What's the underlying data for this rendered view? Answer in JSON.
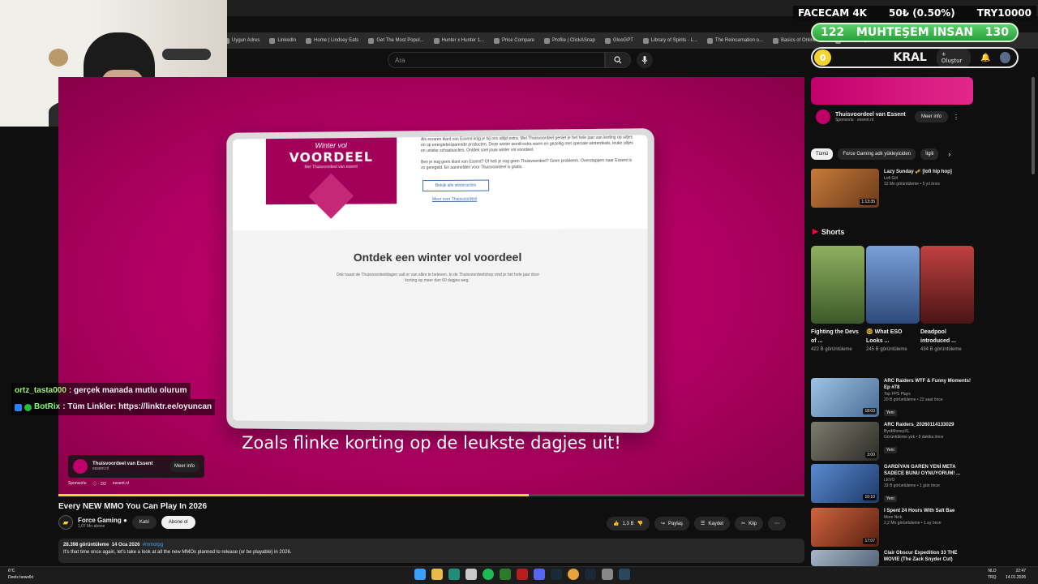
{
  "bookmarks": [
    "Uygun Adres",
    "LinkedIn",
    "Home | Lindsey Eats",
    "Get The Most Popul...",
    "Hunter x Hunter 1...",
    "Price Compare",
    "Profile | ClickASnap",
    "GlooGPT",
    "Library of Spirits - L...",
    "The Reincarnation o...",
    "Basics of Online M...",
    "Tüm Yer İşaretleri"
  ],
  "search": {
    "placeholder": "Ara"
  },
  "overlay": {
    "facecam": "FACECAM 4K",
    "price": "50₺ (0.50%)",
    "goal": "TRY10000",
    "left_num": "122",
    "name": "MUHTEŞEM INSAN",
    "right_num": "130",
    "coin": "0",
    "kral": "KRAL",
    "create": "Oluştur"
  },
  "tablet": {
    "banner_script": "Winter vol",
    "banner_big": "VOORDEEL",
    "banner_small": "Met Thuisvoordeel van essent",
    "para1": "Als ervaren klant van Essent krijg je bij ons altijd extra. Met Thuisvoordeel geniet je het hele jaar van korting op uitjes en op energiebesparende producten. Deze winter wordt extra warm en gezellig met speciale winterdeals, leuke uitjes en unieke schaatsacties. Ontdek snel jouw winter vol voordeel.",
    "para2": "Ben je nog geen klant van Essent? Of heb je nog geen Thuisvoordeel? Geen probleem. Overstappen naar Essent is zo geregeld. En aanmelden voor Thuisvoordeel is gratis.",
    "button": "Bekijk alle winteracties",
    "link": "Meer over Thuisvoordeel",
    "heading": "Ontdek een winter vol voordeel",
    "sub": "Ook naast de Thuisvoordeeldagen valt er van alles te beleven. In de Thuisvoordeelshop vind je het hele jaar door korting op meer dan 60 dagjes weg."
  },
  "video_subtitle": "Zoals flinke korting op de leukste dagjes uit!",
  "chat": [
    {
      "user": "ortz_tasta000",
      "msg": ": gerçek manada mutlu olurum"
    },
    {
      "user": "BotRix",
      "msg": ": Tüm Linkler: https://linktr.ee/oyuncan"
    }
  ],
  "ad": {
    "title": "Thuisvoordeel van Essent",
    "domain": "essent.nl",
    "cta": "Meer info",
    "sponsor": "Sponsorlu",
    "count": "2/2",
    "site": "essent.nl"
  },
  "video": {
    "title": "Every NEW MMO You Can Play In 2026",
    "channel": "Force Gaming",
    "subs": "1,07 Mn abone",
    "join": "Katıl",
    "subscribe": "Abone ol",
    "likes": "1,3 B",
    "share": "Paylaş",
    "save": "Kaydet",
    "clip": "Klip",
    "views": "28.398 görüntüleme",
    "date": "14 Oca 2026",
    "hashtag": "#mmorpg",
    "description": "It's that time once again, let's take a look at all the new MMOs planned to release (or be playable) in 2026."
  },
  "side_ad": {
    "title": "Thuisvoordeel van Essent",
    "sponsor": "Sponsorlu",
    "domain": "essent.nl",
    "cta": "Meer info"
  },
  "chips": [
    "Tümü",
    "Force Gaming adlı yükleyiciden",
    "İlgili"
  ],
  "recs": [
    {
      "title": "Lazy Sunday 🎺 [lofi hip hop]",
      "channel": "Lofi Girl",
      "meta": "12 Mn görüntüleme • 5 yıl önce",
      "dur": "1:13:35",
      "color": "#9c5a2a"
    }
  ],
  "shorts_label": "Shorts",
  "shorts": [
    {
      "title": "Fighting the Devs of ...",
      "views": "422 B görüntüleme",
      "color": "#5d7a3d"
    },
    {
      "title": "🤓 What ESO Looks ...",
      "views": "245 B görüntüleme",
      "color": "#4a6fa8"
    },
    {
      "title": "Deadpool introduced ...",
      "views": "434 B görüntüleme",
      "color": "#8a2b2b"
    }
  ],
  "recs2": [
    {
      "title": "ARC Raiders WTF & Funny Moments! Ep #78",
      "channel": "Top FPS Plays",
      "meta": "20 B görüntüleme • 22 saat önce",
      "badge": "Yeni",
      "dur": "18:03",
      "color": "#6d8fb3"
    },
    {
      "title": "ARC Raiders_20260114133029",
      "channel": "ByrdMoneyXL",
      "meta": "Görüntüleme yok • 9 dakika önce",
      "badge": "Yeni",
      "dur": "3:00",
      "color": "#5a5a50"
    },
    {
      "title": "GARDİYAN GAREN YENİ META SADECE BUNU OYNUYORUM! ...",
      "channel": "LEVO",
      "meta": "33 B görüntüleme • 1 gün önce",
      "badge": "Yeni",
      "dur": "10:10",
      "color": "#3a6db0"
    },
    {
      "title": "I Spent 24 Hours With Salt Bae",
      "channel": "More Nick",
      "meta": "2,2 Mn görüntüleme • 1 ay önce",
      "badge": "",
      "dur": "17:07",
      "color": "#b0442a"
    },
    {
      "title": "Clair Obscur Expedition 33 THE MOVIE (The Zack Snyder Cut)",
      "channel": "",
      "meta": "",
      "badge": "",
      "dur": "",
      "color": "#7a8aa0"
    }
  ],
  "taskbar": {
    "temp": "6°C",
    "weather": "Deels bewolkt",
    "lang1": "NLD",
    "lang2": "TRQ",
    "time": "22:47",
    "date": "14.01.2026"
  }
}
